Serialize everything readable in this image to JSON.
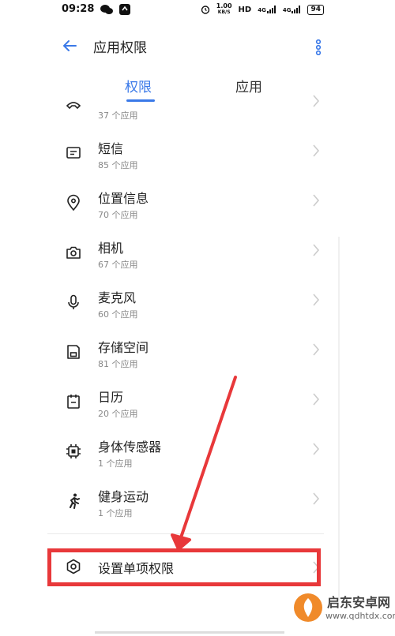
{
  "status_bar": {
    "time": "09:28",
    "net_speed_value": "1.00",
    "net_speed_unit": "KB/S",
    "hd": "HD",
    "signal1": "4G",
    "signal2": "4G",
    "battery": "94"
  },
  "header": {
    "title": "应用权限"
  },
  "tabs": [
    {
      "label": "权限"
    },
    {
      "label": "应用"
    }
  ],
  "permissions": [
    {
      "label": "",
      "count": "37 个应用",
      "icon": "phone-icon"
    },
    {
      "label": "短信",
      "count": "85 个应用",
      "icon": "message-icon"
    },
    {
      "label": "位置信息",
      "count": "70 个应用",
      "icon": "location-icon"
    },
    {
      "label": "相机",
      "count": "67 个应用",
      "icon": "camera-icon"
    },
    {
      "label": "麦克风",
      "count": "60 个应用",
      "icon": "microphone-icon"
    },
    {
      "label": "存储空间",
      "count": "81 个应用",
      "icon": "storage-icon"
    },
    {
      "label": "日历",
      "count": "20 个应用",
      "icon": "calendar-icon"
    },
    {
      "label": "身体传感器",
      "count": "1 个应用",
      "icon": "sensor-icon"
    },
    {
      "label": "健身运动",
      "count": "1 个应用",
      "icon": "fitness-icon"
    }
  ],
  "single_item": {
    "label": "设置单项权限",
    "icon": "settings-icon"
  },
  "watermark": {
    "name": "启东安卓网",
    "url": "www.qdhtdx.com"
  },
  "colors": {
    "accent": "#3a79e8",
    "highlight": "#e8383a"
  }
}
